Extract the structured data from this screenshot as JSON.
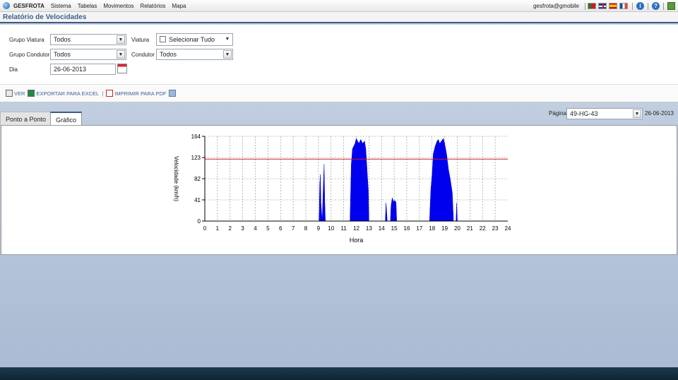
{
  "app": {
    "brand": "GESFROTA"
  },
  "menu": [
    "Sistema",
    "Tabelas",
    "Movimentos",
    "Relatórios",
    "Mapa"
  ],
  "user": "gesfrota@gmobile",
  "page_title": "Relatório de Velocidades",
  "filters": {
    "grupo_viatura_label": "Grupo Viatura",
    "grupo_viatura_value": "Todos",
    "viatura_label": "Viatura",
    "viatura_value": "Selecionar Tudo",
    "grupo_condutor_label": "Grupo Condutor",
    "grupo_condutor_value": "Todos",
    "condutor_label": "Condutor",
    "condutor_value": "Todos",
    "dia_label": "Dia",
    "dia_value": "26-06-2013"
  },
  "toolbar": {
    "ver": "VER",
    "excel": "EXPORTAR PARA EXCEL",
    "pdf": "IMPRIMIR PARA PDF",
    "sep": "|"
  },
  "tabs": [
    "Ponto a Ponto",
    "Gráfico"
  ],
  "paging": {
    "label": "Página",
    "value": "49-HG-43",
    "date": "26-06-2013"
  },
  "chart_data": {
    "type": "area",
    "xlabel": "Hora",
    "ylabel": "Velocidade (km/h)",
    "xlim": [
      0,
      24
    ],
    "ylim": [
      0,
      164
    ],
    "yticks": [
      0,
      41,
      82,
      123,
      164
    ],
    "xticks": [
      0,
      1,
      2,
      3,
      4,
      5,
      6,
      7,
      8,
      9,
      10,
      11,
      12,
      13,
      14,
      15,
      16,
      17,
      18,
      19,
      20,
      21,
      22,
      23,
      24
    ],
    "grid": true,
    "series_color": "#0000ee",
    "limit_line": {
      "value": 120,
      "color": "#cc2222"
    },
    "series": [
      {
        "points": [
          [
            9.05,
            0
          ],
          [
            9.1,
            70
          ],
          [
            9.15,
            90
          ],
          [
            9.2,
            35
          ],
          [
            9.3,
            0
          ],
          [
            9.4,
            75
          ],
          [
            9.45,
            110
          ],
          [
            9.5,
            40
          ],
          [
            9.55,
            0
          ],
          [
            11.5,
            0
          ],
          [
            11.6,
            110
          ],
          [
            11.7,
            140
          ],
          [
            11.8,
            145
          ],
          [
            11.9,
            150
          ],
          [
            12.0,
            160
          ],
          [
            12.1,
            155
          ],
          [
            12.2,
            150
          ],
          [
            12.35,
            158
          ],
          [
            12.5,
            150
          ],
          [
            12.65,
            155
          ],
          [
            12.75,
            140
          ],
          [
            12.85,
            100
          ],
          [
            12.95,
            60
          ],
          [
            13.0,
            0
          ],
          [
            14.3,
            0
          ],
          [
            14.35,
            35
          ],
          [
            14.4,
            20
          ],
          [
            14.45,
            0
          ],
          [
            14.7,
            0
          ],
          [
            14.75,
            30
          ],
          [
            14.85,
            45
          ],
          [
            14.95,
            38
          ],
          [
            15.05,
            40
          ],
          [
            15.15,
            36
          ],
          [
            15.2,
            0
          ],
          [
            17.8,
            0
          ],
          [
            17.9,
            60
          ],
          [
            18.0,
            90
          ],
          [
            18.1,
            130
          ],
          [
            18.25,
            145
          ],
          [
            18.4,
            155
          ],
          [
            18.5,
            158
          ],
          [
            18.6,
            150
          ],
          [
            18.75,
            155
          ],
          [
            18.9,
            160
          ],
          [
            19.0,
            150
          ],
          [
            19.15,
            130
          ],
          [
            19.3,
            100
          ],
          [
            19.45,
            80
          ],
          [
            19.6,
            55
          ],
          [
            19.7,
            0
          ],
          [
            19.9,
            0
          ],
          [
            19.95,
            35
          ],
          [
            20.0,
            0
          ]
        ]
      }
    ]
  }
}
